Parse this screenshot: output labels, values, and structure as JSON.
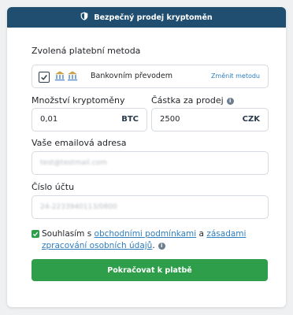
{
  "header": {
    "title": "Bezpečný prodej kryptoměn",
    "icon": "shield-icon"
  },
  "payment_method": {
    "label": "Zvolená platební metoda",
    "checked": true,
    "name": "Bankovním převodem",
    "change_label": "Změnit metodu",
    "icon": "bank-icon"
  },
  "amount_crypto": {
    "label": "Množství kryptoměny",
    "value": "0,01",
    "unit": "BTC"
  },
  "amount_sale": {
    "label": "Částka za prodej",
    "value": "2500",
    "unit": "CZK",
    "info_icon": "i"
  },
  "email": {
    "label": "Vaše emailová adresa",
    "value": "test@testmail.com"
  },
  "account": {
    "label": "Číslo účtu",
    "value": "24-2233940113/0800"
  },
  "consent": {
    "checked": true,
    "text_1": "Souhlasím s ",
    "link_terms": "obchodními podmínkami",
    "text_2": " a ",
    "link_privacy": "zásadami zpracování osobních údajů",
    "text_3": ".",
    "info_icon": "i"
  },
  "submit": {
    "label": "Pokračovat k platbě"
  },
  "colors": {
    "header_bg": "#1f4e70",
    "accent_green": "#2e9e4a",
    "link_blue": "#2e7dbd"
  }
}
